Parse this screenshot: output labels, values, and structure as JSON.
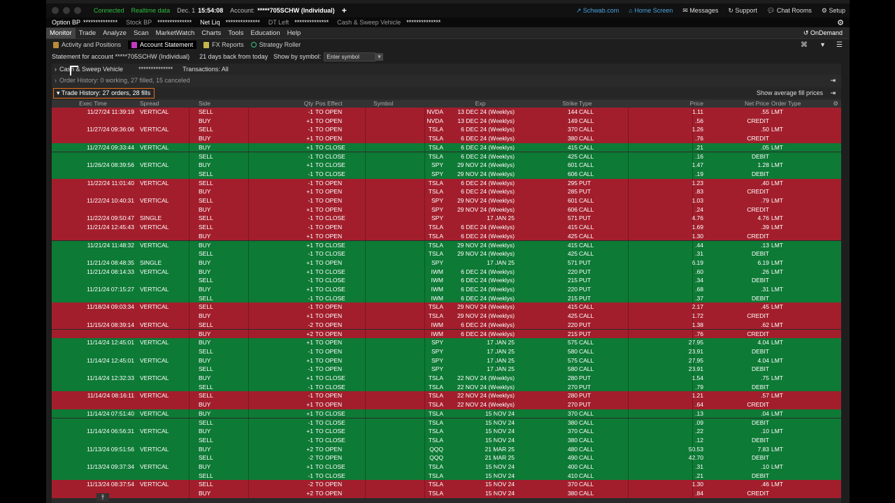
{
  "topbar": {
    "connected": "Connected",
    "realtime": "Realtime data",
    "date": "Dec. 1",
    "time": "15:54:08",
    "account_label": "Account:",
    "account": "*****705SCHW (Individual)",
    "plus": "+",
    "schwab": "Schwab.com",
    "home": "Home Screen",
    "messages": "Messages",
    "support": "Support",
    "chat": "Chat Rooms",
    "setup": "Setup"
  },
  "secbar": {
    "option_bp": "Option BP",
    "option_bp_val": "**************",
    "stock_bp": "Stock BP",
    "stock_bp_val": "**************",
    "net_liq": "Net Liq",
    "net_liq_val": "**************",
    "dt_left": "DT Left",
    "dt_left_val": "**************",
    "cash_sweep": "Cash & Sweep Vehicle",
    "cash_sweep_val": "**************"
  },
  "nav": [
    "Monitor",
    "Trade",
    "Analyze",
    "Scan",
    "MarketWatch",
    "Charts",
    "Tools",
    "Education",
    "Help"
  ],
  "ondemand": "OnDemand",
  "subnav": [
    "Activity and Positions",
    "Account Statement",
    "FX Reports",
    "Strategy Roller"
  ],
  "stmt": {
    "label": "Statement for account *****705SCHW (Individual)",
    "days": "21 days back from today",
    "show_by": "Show by symbol:",
    "search_placeholder": "Enter symbol"
  },
  "panel": {
    "cash_label": "Cash & Sweep Vehicle",
    "cash_val": "**************",
    "transactions": "Transactions: All",
    "order_history": "Order History: 0 working, 27 filled, 15 canceled",
    "trade_history": "Trade History: 27 orders, 28 fills",
    "show_avg": "Show average fill prices"
  },
  "columns": [
    "Exec Time",
    "Spread",
    "Side",
    "Qty",
    "Pos Effect",
    "Symbol",
    "Exp",
    "Strike",
    "Type",
    "Price",
    "Net Price",
    "Order Type"
  ],
  "rows": [
    {
      "c": "red",
      "t": "11/27/24 11:39:19",
      "sp": "VERTICAL",
      "sd": "SELL",
      "q": "-1",
      "pe": "TO OPEN",
      "sy": "NVDA",
      "ex": "13 DEC 24 (Weeklys)",
      "st": "144",
      "ty": "CALL",
      "pr": "1.11",
      "np": ".55",
      "ot": "LMT"
    },
    {
      "c": "red",
      "t": "",
      "sp": "",
      "sd": "BUY",
      "q": "+1",
      "pe": "TO OPEN",
      "sy": "NVDA",
      "ex": "13 DEC 24 (Weeklys)",
      "st": "149",
      "ty": "CALL",
      "pr": ".56",
      "np": "CREDIT",
      "ot": ""
    },
    {
      "c": "red",
      "t": "11/27/24 09:36:06",
      "sp": "VERTICAL",
      "sd": "SELL",
      "q": "-1",
      "pe": "TO OPEN",
      "sy": "TSLA",
      "ex": "6 DEC 24 (Weeklys)",
      "st": "370",
      "ty": "CALL",
      "pr": "1.26",
      "np": ".50",
      "ot": "LMT"
    },
    {
      "c": "red",
      "t": "",
      "sp": "",
      "sd": "BUY",
      "q": "+1",
      "pe": "TO OPEN",
      "sy": "TSLA",
      "ex": "6 DEC 24 (Weeklys)",
      "st": "380",
      "ty": "CALL",
      "pr": ".76",
      "np": "CREDIT",
      "ot": ""
    },
    {
      "c": "grn",
      "t": "11/27/24 09:33:44",
      "sp": "VERTICAL",
      "sd": "BUY",
      "q": "+1",
      "pe": "TO CLOSE",
      "sy": "TSLA",
      "ex": "6 DEC 24 (Weeklys)",
      "st": "415",
      "ty": "CALL",
      "pr": ".21",
      "np": ".05",
      "ot": "LMT"
    },
    {
      "c": "grn",
      "t": "",
      "sp": "",
      "sd": "SELL",
      "q": "-1",
      "pe": "TO CLOSE",
      "sy": "TSLA",
      "ex": "6 DEC 24 (Weeklys)",
      "st": "425",
      "ty": "CALL",
      "pr": ".16",
      "np": "DEBIT",
      "ot": ""
    },
    {
      "c": "grn",
      "t": "11/26/24 08:39:56",
      "sp": "VERTICAL",
      "sd": "BUY",
      "q": "+1",
      "pe": "TO CLOSE",
      "sy": "SPY",
      "ex": "29 NOV 24 (Weeklys)",
      "st": "601",
      "ty": "CALL",
      "pr": "1.47",
      "np": "1.28",
      "ot": "LMT"
    },
    {
      "c": "grn",
      "t": "",
      "sp": "",
      "sd": "SELL",
      "q": "-1",
      "pe": "TO CLOSE",
      "sy": "SPY",
      "ex": "29 NOV 24 (Weeklys)",
      "st": "606",
      "ty": "CALL",
      "pr": ".19",
      "np": "DEBIT",
      "ot": ""
    },
    {
      "c": "red",
      "t": "11/22/24 11:01:40",
      "sp": "VERTICAL",
      "sd": "SELL",
      "q": "-1",
      "pe": "TO OPEN",
      "sy": "TSLA",
      "ex": "6 DEC 24 (Weeklys)",
      "st": "295",
      "ty": "PUT",
      "pr": "1.23",
      "np": ".40",
      "ot": "LMT"
    },
    {
      "c": "red",
      "t": "",
      "sp": "",
      "sd": "BUY",
      "q": "+1",
      "pe": "TO OPEN",
      "sy": "TSLA",
      "ex": "6 DEC 24 (Weeklys)",
      "st": "285",
      "ty": "PUT",
      "pr": ".83",
      "np": "CREDIT",
      "ot": ""
    },
    {
      "c": "red",
      "t": "11/22/24 10:40:31",
      "sp": "VERTICAL",
      "sd": "SELL",
      "q": "-1",
      "pe": "TO OPEN",
      "sy": "SPY",
      "ex": "29 NOV 24 (Weeklys)",
      "st": "601",
      "ty": "CALL",
      "pr": "1.03",
      "np": ".79",
      "ot": "LMT"
    },
    {
      "c": "red",
      "t": "",
      "sp": "",
      "sd": "BUY",
      "q": "+1",
      "pe": "TO OPEN",
      "sy": "SPY",
      "ex": "29 NOV 24 (Weeklys)",
      "st": "606",
      "ty": "CALL",
      "pr": ".24",
      "np": "CREDIT",
      "ot": ""
    },
    {
      "c": "red",
      "t": "11/22/24 09:50:47",
      "sp": "SINGLE",
      "sd": "SELL",
      "q": "-1",
      "pe": "TO CLOSE",
      "sy": "SPY",
      "ex": "17 JAN 25",
      "st": "571",
      "ty": "PUT",
      "pr": "4.76",
      "np": "4.76",
      "ot": "LMT"
    },
    {
      "c": "red",
      "t": "11/21/24 12:45:43",
      "sp": "VERTICAL",
      "sd": "SELL",
      "q": "-1",
      "pe": "TO OPEN",
      "sy": "TSLA",
      "ex": "6 DEC 24 (Weeklys)",
      "st": "415",
      "ty": "CALL",
      "pr": "1.69",
      "np": ".39",
      "ot": "LMT"
    },
    {
      "c": "red",
      "t": "",
      "sp": "",
      "sd": "BUY",
      "q": "+1",
      "pe": "TO OPEN",
      "sy": "TSLA",
      "ex": "6 DEC 24 (Weeklys)",
      "st": "425",
      "ty": "CALL",
      "pr": "1.30",
      "np": "CREDIT",
      "ot": ""
    },
    {
      "c": "grn",
      "t": "11/21/24 11:48:32",
      "sp": "VERTICAL",
      "sd": "BUY",
      "q": "+1",
      "pe": "TO CLOSE",
      "sy": "TSLA",
      "ex": "29 NOV 24 (Weeklys)",
      "st": "415",
      "ty": "CALL",
      "pr": ".44",
      "np": ".13",
      "ot": "LMT"
    },
    {
      "c": "grn",
      "t": "",
      "sp": "",
      "sd": "SELL",
      "q": "-1",
      "pe": "TO CLOSE",
      "sy": "TSLA",
      "ex": "29 NOV 24 (Weeklys)",
      "st": "425",
      "ty": "CALL",
      "pr": ".31",
      "np": "DEBIT",
      "ot": ""
    },
    {
      "c": "grn",
      "t": "11/21/24 08:48:35",
      "sp": "SINGLE",
      "sd": "BUY",
      "q": "+1",
      "pe": "TO OPEN",
      "sy": "SPY",
      "ex": "17 JAN 25",
      "st": "571",
      "ty": "PUT",
      "pr": "6.19",
      "np": "6.19",
      "ot": "LMT"
    },
    {
      "c": "grn",
      "t": "11/21/24 08:14:33",
      "sp": "VERTICAL",
      "sd": "BUY",
      "q": "+1",
      "pe": "TO CLOSE",
      "sy": "IWM",
      "ex": "6 DEC 24 (Weeklys)",
      "st": "220",
      "ty": "PUT",
      "pr": ".60",
      "np": ".26",
      "ot": "LMT"
    },
    {
      "c": "grn",
      "t": "",
      "sp": "",
      "sd": "SELL",
      "q": "-1",
      "pe": "TO CLOSE",
      "sy": "IWM",
      "ex": "6 DEC 24 (Weeklys)",
      "st": "215",
      "ty": "PUT",
      "pr": ".34",
      "np": "DEBIT",
      "ot": ""
    },
    {
      "c": "grn",
      "t": "11/21/24 07:15:27",
      "sp": "VERTICAL",
      "sd": "BUY",
      "q": "+1",
      "pe": "TO CLOSE",
      "sy": "IWM",
      "ex": "6 DEC 24 (Weeklys)",
      "st": "220",
      "ty": "PUT",
      "pr": ".68",
      "np": ".31",
      "ot": "LMT"
    },
    {
      "c": "grn",
      "t": "",
      "sp": "",
      "sd": "SELL",
      "q": "-1",
      "pe": "TO CLOSE",
      "sy": "IWM",
      "ex": "6 DEC 24 (Weeklys)",
      "st": "215",
      "ty": "PUT",
      "pr": ".37",
      "np": "DEBIT",
      "ot": ""
    },
    {
      "c": "red",
      "t": "11/18/24 09:03:34",
      "sp": "VERTICAL",
      "sd": "SELL",
      "q": "-1",
      "pe": "TO OPEN",
      "sy": "TSLA",
      "ex": "29 NOV 24 (Weeklys)",
      "st": "415",
      "ty": "CALL",
      "pr": "2.17",
      "np": ".45",
      "ot": "LMT"
    },
    {
      "c": "red",
      "t": "",
      "sp": "",
      "sd": "BUY",
      "q": "+1",
      "pe": "TO OPEN",
      "sy": "TSLA",
      "ex": "29 NOV 24 (Weeklys)",
      "st": "425",
      "ty": "CALL",
      "pr": "1.72",
      "np": "CREDIT",
      "ot": ""
    },
    {
      "c": "red",
      "t": "11/15/24 08:39:14",
      "sp": "VERTICAL",
      "sd": "SELL",
      "q": "-2",
      "pe": "TO OPEN",
      "sy": "IWM",
      "ex": "6 DEC 24 (Weeklys)",
      "st": "220",
      "ty": "PUT",
      "pr": "1.38",
      "np": ".62",
      "ot": "LMT"
    },
    {
      "c": "red",
      "t": "",
      "sp": "",
      "sd": "BUY",
      "q": "+2",
      "pe": "TO OPEN",
      "sy": "IWM",
      "ex": "6 DEC 24 (Weeklys)",
      "st": "215",
      "ty": "PUT",
      "pr": ".76",
      "np": "CREDIT",
      "ot": ""
    },
    {
      "c": "grn",
      "t": "11/14/24 12:45:01",
      "sp": "VERTICAL",
      "sd": "BUY",
      "q": "+1",
      "pe": "TO OPEN",
      "sy": "SPY",
      "ex": "17 JAN 25",
      "st": "575",
      "ty": "CALL",
      "pr": "27.95",
      "np": "4.04",
      "ot": "LMT"
    },
    {
      "c": "grn",
      "t": "",
      "sp": "",
      "sd": "SELL",
      "q": "-1",
      "pe": "TO OPEN",
      "sy": "SPY",
      "ex": "17 JAN 25",
      "st": "580",
      "ty": "CALL",
      "pr": "23.91",
      "np": "DEBIT",
      "ot": ""
    },
    {
      "c": "grn",
      "t": "11/14/24 12:45:01",
      "sp": "VERTICAL",
      "sd": "BUY",
      "q": "+1",
      "pe": "TO OPEN",
      "sy": "SPY",
      "ex": "17 JAN 25",
      "st": "575",
      "ty": "CALL",
      "pr": "27.95",
      "np": "4.04",
      "ot": "LMT"
    },
    {
      "c": "grn",
      "t": "",
      "sp": "",
      "sd": "SELL",
      "q": "-1",
      "pe": "TO OPEN",
      "sy": "SPY",
      "ex": "17 JAN 25",
      "st": "580",
      "ty": "CALL",
      "pr": "23.91",
      "np": "DEBIT",
      "ot": ""
    },
    {
      "c": "grn",
      "t": "11/14/24 12:32:33",
      "sp": "VERTICAL",
      "sd": "BUY",
      "q": "+1",
      "pe": "TO CLOSE",
      "sy": "TSLA",
      "ex": "22 NOV 24 (Weeklys)",
      "st": "280",
      "ty": "PUT",
      "pr": "1.54",
      "np": ".75",
      "ot": "LMT"
    },
    {
      "c": "grn",
      "t": "",
      "sp": "",
      "sd": "SELL",
      "q": "-1",
      "pe": "TO CLOSE",
      "sy": "TSLA",
      "ex": "22 NOV 24 (Weeklys)",
      "st": "270",
      "ty": "PUT",
      "pr": ".79",
      "np": "DEBIT",
      "ot": ""
    },
    {
      "c": "red",
      "t": "11/14/24 08:16:11",
      "sp": "VERTICAL",
      "sd": "SELL",
      "q": "-1",
      "pe": "TO OPEN",
      "sy": "TSLA",
      "ex": "22 NOV 24 (Weeklys)",
      "st": "280",
      "ty": "PUT",
      "pr": "1.21",
      "np": ".57",
      "ot": "LMT"
    },
    {
      "c": "red",
      "t": "",
      "sp": "",
      "sd": "BUY",
      "q": "+1",
      "pe": "TO OPEN",
      "sy": "TSLA",
      "ex": "22 NOV 24 (Weeklys)",
      "st": "270",
      "ty": "PUT",
      "pr": ".64",
      "np": "CREDIT",
      "ot": ""
    },
    {
      "c": "grn",
      "t": "11/14/24 07:51:40",
      "sp": "VERTICAL",
      "sd": "BUY",
      "q": "+1",
      "pe": "TO CLOSE",
      "sy": "TSLA",
      "ex": "15 NOV 24",
      "st": "370",
      "ty": "CALL",
      "pr": ".13",
      "np": ".04",
      "ot": "LMT"
    },
    {
      "c": "grn",
      "t": "",
      "sp": "",
      "sd": "SELL",
      "q": "-1",
      "pe": "TO CLOSE",
      "sy": "TSLA",
      "ex": "15 NOV 24",
      "st": "380",
      "ty": "CALL",
      "pr": ".09",
      "np": "DEBIT",
      "ot": ""
    },
    {
      "c": "grn",
      "t": "11/14/24 06:56:31",
      "sp": "VERTICAL",
      "sd": "BUY",
      "q": "+1",
      "pe": "TO CLOSE",
      "sy": "TSLA",
      "ex": "15 NOV 24",
      "st": "370",
      "ty": "CALL",
      "pr": ".22",
      "np": ".10",
      "ot": "LMT"
    },
    {
      "c": "grn",
      "t": "",
      "sp": "",
      "sd": "SELL",
      "q": "-1",
      "pe": "TO CLOSE",
      "sy": "TSLA",
      "ex": "15 NOV 24",
      "st": "380",
      "ty": "CALL",
      "pr": ".12",
      "np": "DEBIT",
      "ot": ""
    },
    {
      "c": "grn",
      "t": "11/13/24 09:51:56",
      "sp": "VERTICAL",
      "sd": "BUY",
      "q": "+2",
      "pe": "TO OPEN",
      "sy": "QQQ",
      "ex": "21 MAR 25",
      "st": "480",
      "ty": "CALL",
      "pr": "50.53",
      "np": "7.83",
      "ot": "LMT"
    },
    {
      "c": "grn",
      "t": "",
      "sp": "",
      "sd": "SELL",
      "q": "-2",
      "pe": "TO OPEN",
      "sy": "QQQ",
      "ex": "21 MAR 25",
      "st": "490",
      "ty": "CALL",
      "pr": "42.70",
      "np": "DEBIT",
      "ot": ""
    },
    {
      "c": "grn",
      "t": "11/13/24 09:37:34",
      "sp": "VERTICAL",
      "sd": "BUY",
      "q": "+1",
      "pe": "TO CLOSE",
      "sy": "TSLA",
      "ex": "15 NOV 24",
      "st": "400",
      "ty": "CALL",
      "pr": ".31",
      "np": ".10",
      "ot": "LMT"
    },
    {
      "c": "grn",
      "t": "",
      "sp": "",
      "sd": "SELL",
      "q": "-1",
      "pe": "TO CLOSE",
      "sy": "TSLA",
      "ex": "15 NOV 24",
      "st": "410",
      "ty": "CALL",
      "pr": ".21",
      "np": "DEBIT",
      "ot": ""
    },
    {
      "c": "red",
      "t": "11/13/24 08:37:54",
      "sp": "VERTICAL",
      "sd": "SELL",
      "q": "-2",
      "pe": "TO OPEN",
      "sy": "TSLA",
      "ex": "15 NOV 24",
      "st": "370",
      "ty": "CALL",
      "pr": "1.30",
      "np": ".46",
      "ot": "LMT"
    },
    {
      "c": "red",
      "t": "",
      "sp": "",
      "sd": "BUY",
      "q": "+2",
      "pe": "TO OPEN",
      "sy": "TSLA",
      "ex": "15 NOV 24",
      "st": "380",
      "ty": "CALL",
      "pr": ".84",
      "np": "CREDIT",
      "ot": ""
    }
  ],
  "colors": {
    "red_row": "#a31e2c",
    "green_row": "#0d7a35",
    "accent": "#e86c1e",
    "connected": "#2fbf3f",
    "link": "#4aa3e0"
  }
}
